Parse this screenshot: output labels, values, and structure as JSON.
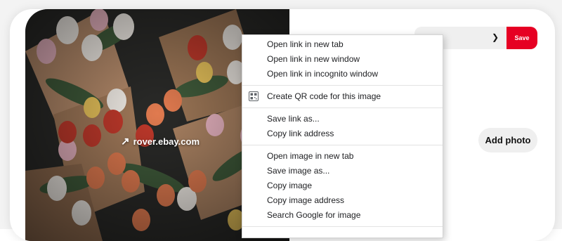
{
  "pin": {
    "source_domain": "rover.ebay.com",
    "add_photo_label": "Add photo",
    "save_label": "Save",
    "board_select_value": ""
  },
  "context_menu": {
    "groups": [
      [
        "Open link in new tab",
        "Open link in new window",
        "Open link in incognito window"
      ],
      [
        "Create QR code for this image"
      ],
      [
        "Save link as...",
        "Copy link address"
      ],
      [
        "Open image in new tab",
        "Save image as...",
        "Copy image",
        "Copy image address",
        "Search Google for image"
      ]
    ]
  },
  "icons": {
    "board_dropdown": "chevron-down-icon",
    "external_link": "arrow-up-right-icon",
    "qr_code": "qr-code-icon"
  },
  "colors": {
    "save_button": "#e60023",
    "menu_text": "#202124"
  }
}
